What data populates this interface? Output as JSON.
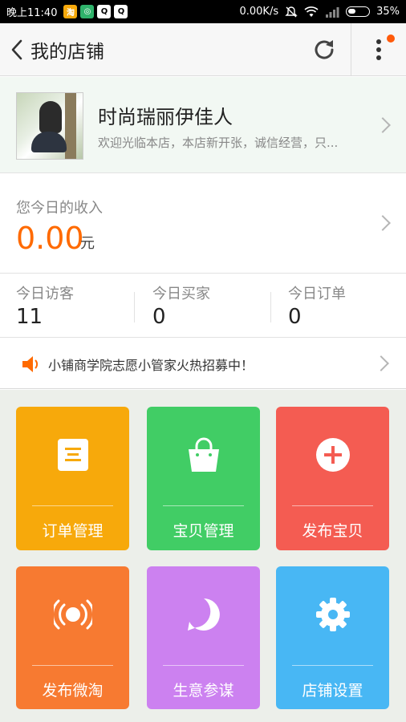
{
  "status_bar": {
    "time": "晚上11:40",
    "network_speed": "0.00K/s",
    "battery": "35%"
  },
  "header": {
    "title": "我的店铺"
  },
  "shop": {
    "name": "时尚瑞丽伊佳人",
    "description": "欢迎光临本店，本店新开张，诚信经营，只..."
  },
  "income": {
    "label": "您今日的收入",
    "value": "0.00",
    "unit": "元"
  },
  "stats": [
    {
      "label": "今日访客",
      "value": "11"
    },
    {
      "label": "今日买家",
      "value": "0"
    },
    {
      "label": "今日订单",
      "value": "0"
    }
  ],
  "notice": {
    "text": "小铺商学院志愿小管家火热招募中！"
  },
  "tiles": [
    {
      "label": "订单管理",
      "icon": "order-list-icon",
      "color": "#f7a90b"
    },
    {
      "label": "宝贝管理",
      "icon": "shopping-bag-icon",
      "color": "#41cd65"
    },
    {
      "label": "发布宝贝",
      "icon": "add-circle-icon",
      "color": "#f45c52"
    },
    {
      "label": "发布微淘",
      "icon": "broadcast-icon",
      "color": "#f77a31"
    },
    {
      "label": "生意参谋",
      "icon": "compass-icon",
      "color": "#cc81f0"
    },
    {
      "label": "店铺设置",
      "icon": "gear-icon",
      "color": "#48b7f4"
    }
  ],
  "colors": {
    "accent": "#ff6a00",
    "shop_card_bg": "#f2f8f3",
    "grid_bg": "#ecefea"
  }
}
